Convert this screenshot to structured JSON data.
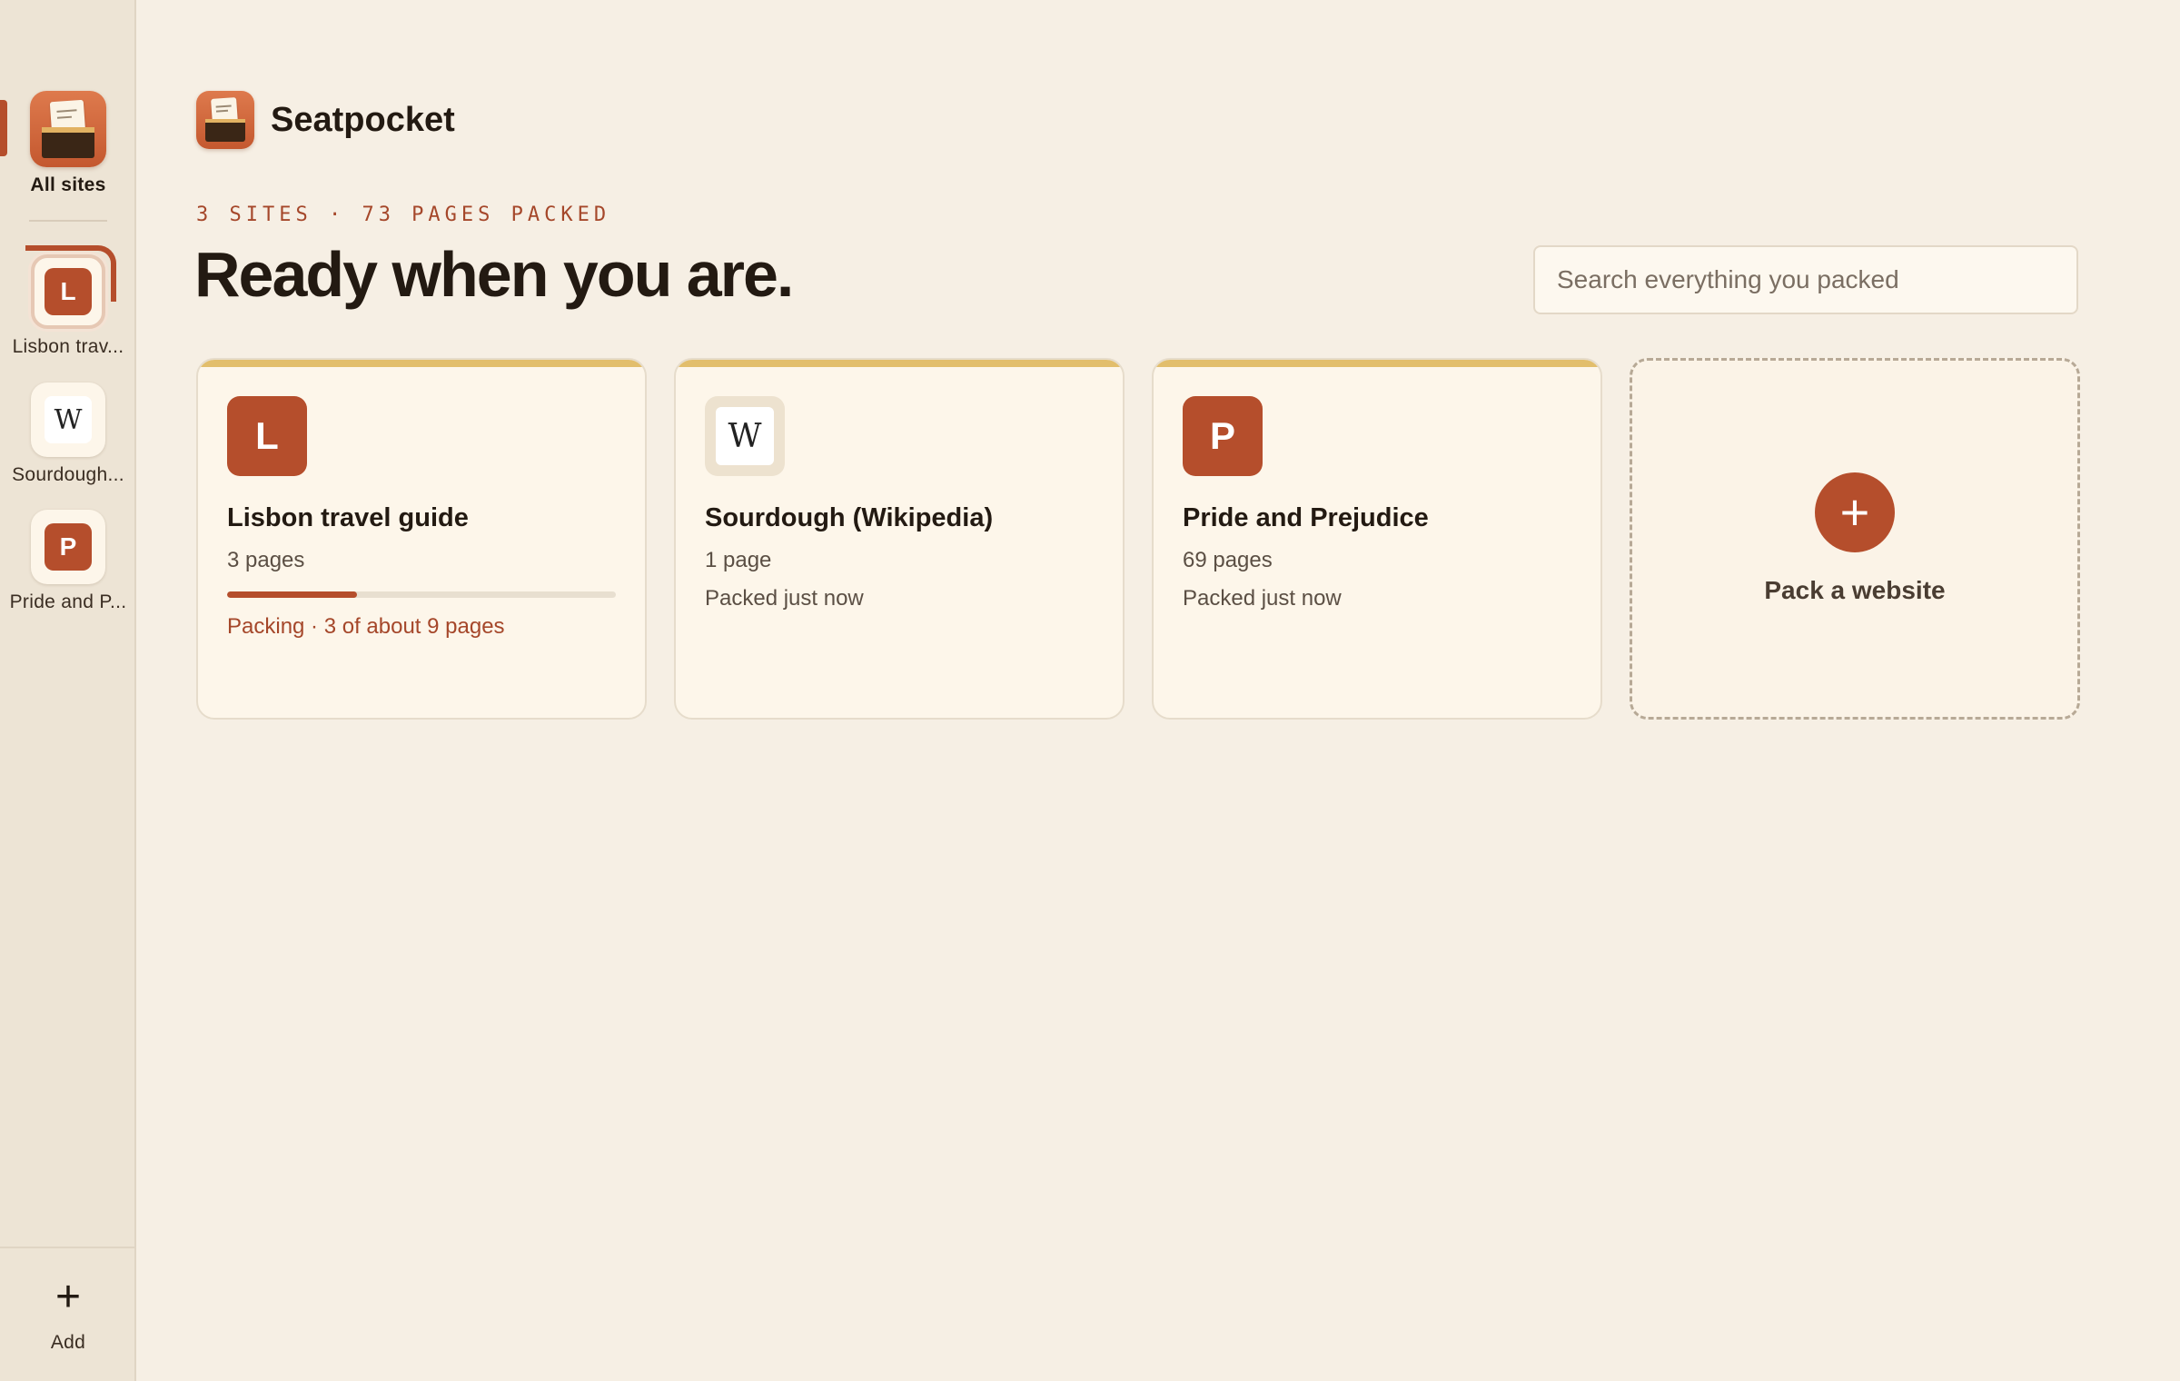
{
  "app": {
    "name": "Seatpocket"
  },
  "sidebar": {
    "all_sites_label": "All sites",
    "items": [
      {
        "label": "Lisbon trav...",
        "letter": "L",
        "kind": "letter",
        "selected": true
      },
      {
        "label": "Sourdough...",
        "letter": "W",
        "kind": "wiki",
        "selected": false
      },
      {
        "label": "Pride and P...",
        "letter": "P",
        "kind": "letter",
        "selected": false
      }
    ],
    "add_glyph": "+",
    "add_label": "Add"
  },
  "header": {
    "eyebrow": "3 SITES · 73 PAGES PACKED",
    "headline": "Ready when you are."
  },
  "search": {
    "placeholder": "Search everything you packed",
    "value": ""
  },
  "cards": [
    {
      "icon_letter": "L",
      "title": "Lisbon travel guide",
      "pages": "3 pages",
      "progress_fraction": 0.333,
      "status": "Packing · 3 of about 9 pages"
    },
    {
      "icon_letter": "W",
      "title": "Sourdough (Wikipedia)",
      "pages": "1 page",
      "status": "Packed just now"
    },
    {
      "icon_letter": "P",
      "title": "Pride and Prejudice",
      "pages": "69 pages",
      "status": "Packed just now"
    }
  ],
  "add_card": {
    "glyph": "+",
    "label": "Pack a website"
  },
  "colors": {
    "accent": "#b54e2c",
    "card_top_stripe": "#e2be6c",
    "background": "#f6efe4",
    "sidebar": "#ede4d5"
  }
}
